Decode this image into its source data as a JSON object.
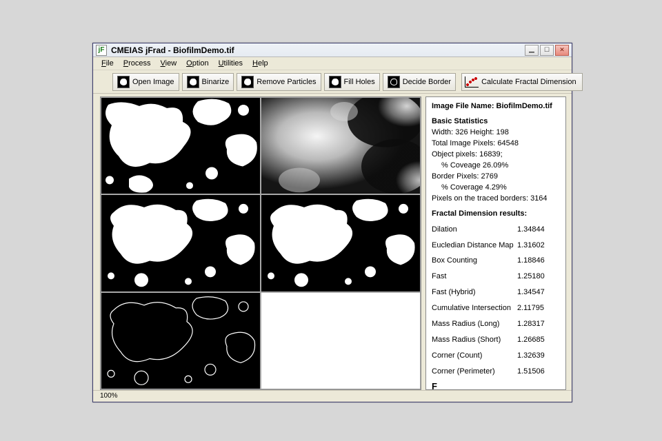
{
  "titlebar": {
    "appicon_text": "jF",
    "title": "CMEIAS jFrad - BiofilmDemo.tif"
  },
  "menu": [
    "File",
    "Process",
    "View",
    "Option",
    "Utilities",
    "Help"
  ],
  "toolbar": {
    "open": "Open Image",
    "binarize": "Binarize",
    "remove": "Remove Particles",
    "fill": "Fill Holes",
    "border": "Decide Border",
    "calc": "Calculate Fractal Dimension"
  },
  "side": {
    "filename_label": "Image File Name:",
    "filename_value": "BiofilmDemo.tif",
    "basic_title": "Basic Statistics",
    "dims": "Width: 326   Height: 198",
    "total_pixels": "Total Image Pixels: 64548",
    "object_pixels": "Object pixels: 16839;",
    "object_cov": "% Coveage 26.09%",
    "border_pixels": "Border Pixels: 2769",
    "border_cov": "% Coverage  4.29%",
    "traced": "Pixels on the traced borders:  3164",
    "fractal_title": "Fractal Dimension results:",
    "rows": [
      {
        "lbl": "Dilation",
        "val": "1.34844"
      },
      {
        "lbl": "Eucledian Distance Map",
        "val": "1.31602"
      },
      {
        "lbl": "Box Counting",
        "val": "1.18846"
      },
      {
        "lbl": "Fast",
        "val": "1.25180"
      },
      {
        "lbl": "Fast (Hybrid)",
        "val": "1.34547"
      },
      {
        "lbl": "Cumulative Intersection",
        "val": "2.11795"
      },
      {
        "lbl": "Mass Radius (Long)",
        "val": "1.28317"
      },
      {
        "lbl": "Mass Radius (Short)",
        "val": "1.26685"
      },
      {
        "lbl": "Corner (Count)",
        "val": "1.32639"
      },
      {
        "lbl": "Corner (Perimeter)",
        "val": "1.51506"
      }
    ],
    "tail": "F"
  },
  "status": {
    "zoom": "100%"
  }
}
